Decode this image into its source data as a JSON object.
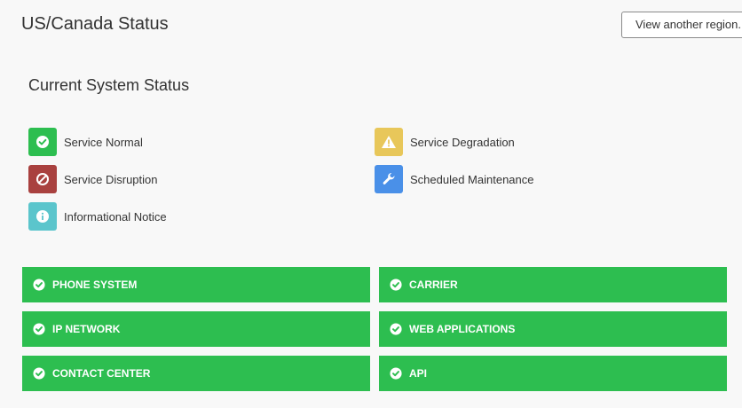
{
  "header": {
    "title": "US/Canada Status",
    "region_button_label": "View another region."
  },
  "section": {
    "title": "Current System Status"
  },
  "legend": [
    {
      "label": "Service Normal",
      "icon": "check-circle-icon",
      "color": "#2dbe50"
    },
    {
      "label": "Service Degradation",
      "icon": "warning-icon",
      "color": "#e8c75a"
    },
    {
      "label": "Service Disruption",
      "icon": "ban-icon",
      "color": "#a9413f"
    },
    {
      "label": "Scheduled Maintenance",
      "icon": "wrench-icon",
      "color": "#4a90e8"
    },
    {
      "label": "Informational Notice",
      "icon": "info-icon",
      "color": "#5bc5cc"
    }
  ],
  "services": [
    {
      "name": "PHONE SYSTEM",
      "status": "Service Normal"
    },
    {
      "name": "CARRIER",
      "status": "Service Normal"
    },
    {
      "name": "IP NETWORK",
      "status": "Service Normal"
    },
    {
      "name": "WEB APPLICATIONS",
      "status": "Service Normal"
    },
    {
      "name": "CONTACT CENTER",
      "status": "Service Normal"
    },
    {
      "name": "API",
      "status": "Service Normal"
    }
  ],
  "colors": {
    "normal": "#2dbe50",
    "background": "#f8f8f8"
  }
}
